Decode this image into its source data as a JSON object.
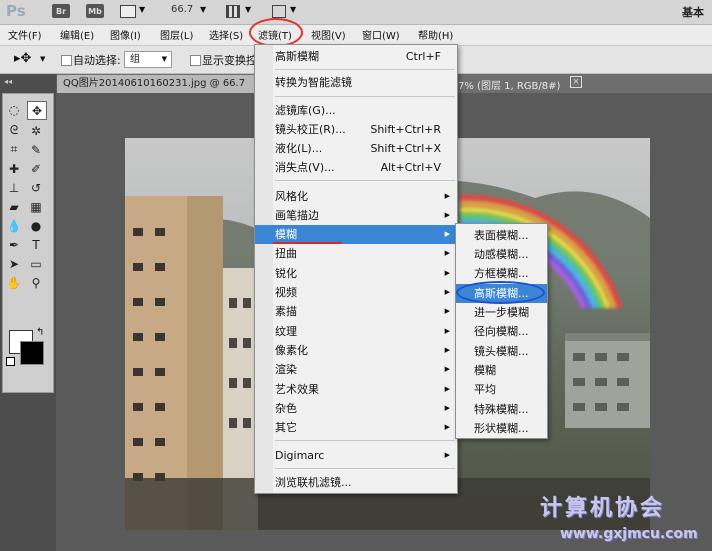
{
  "app": {
    "logo": "Ps",
    "bridge_btn": "Br",
    "minibridge_btn": "Mb",
    "zoom": "66.7",
    "workspace": "基本"
  },
  "menubar": [
    "文件(F)",
    "编辑(E)",
    "图像(I)",
    "图层(L)",
    "选择(S)",
    "滤镜(T)",
    "视图(V)",
    "窗口(W)",
    "帮助(H)"
  ],
  "options": {
    "auto_select_label": "自动选择:",
    "auto_select_value": "组",
    "show_transform_label": "显示变换控"
  },
  "document": {
    "tab_title": "QQ图片20140610160231.jpg @ 66.7",
    "tab_tail": "7% (图层 1, RGB/8#)",
    "tab_close": "×"
  },
  "filter_menu": {
    "items": [
      {
        "label": "高斯模糊",
        "shortcut": "Ctrl+F"
      },
      {
        "label": "转换为智能滤镜"
      },
      {
        "label": "滤镜库(G)..."
      },
      {
        "label": "镜头校正(R)...",
        "shortcut": "Shift+Ctrl+R"
      },
      {
        "label": "液化(L)...",
        "shortcut": "Shift+Ctrl+X"
      },
      {
        "label": "消失点(V)...",
        "shortcut": "Alt+Ctrl+V"
      },
      {
        "label": "风格化"
      },
      {
        "label": "画笔描边"
      },
      {
        "label": "模糊"
      },
      {
        "label": "扭曲"
      },
      {
        "label": "锐化"
      },
      {
        "label": "视频"
      },
      {
        "label": "素描"
      },
      {
        "label": "纹理"
      },
      {
        "label": "像素化"
      },
      {
        "label": "渲染"
      },
      {
        "label": "艺术效果"
      },
      {
        "label": "杂色"
      },
      {
        "label": "其它"
      },
      {
        "label": "Digimarc"
      },
      {
        "label": "浏览联机滤镜..."
      }
    ]
  },
  "blur_submenu": {
    "items": [
      "表面模糊...",
      "动感模糊...",
      "方框模糊...",
      "高斯模糊...",
      "进一步模糊",
      "径向模糊...",
      "镜头模糊...",
      "模糊",
      "平均",
      "特殊模糊...",
      "形状模糊..."
    ]
  },
  "watermark": {
    "cn": "计算机协会",
    "url": "www.gxjmcu.com"
  },
  "colors": {
    "highlight": "#3a86d4",
    "annotation_red": "#e0342b",
    "annotation_blue": "#1f4fd1"
  }
}
